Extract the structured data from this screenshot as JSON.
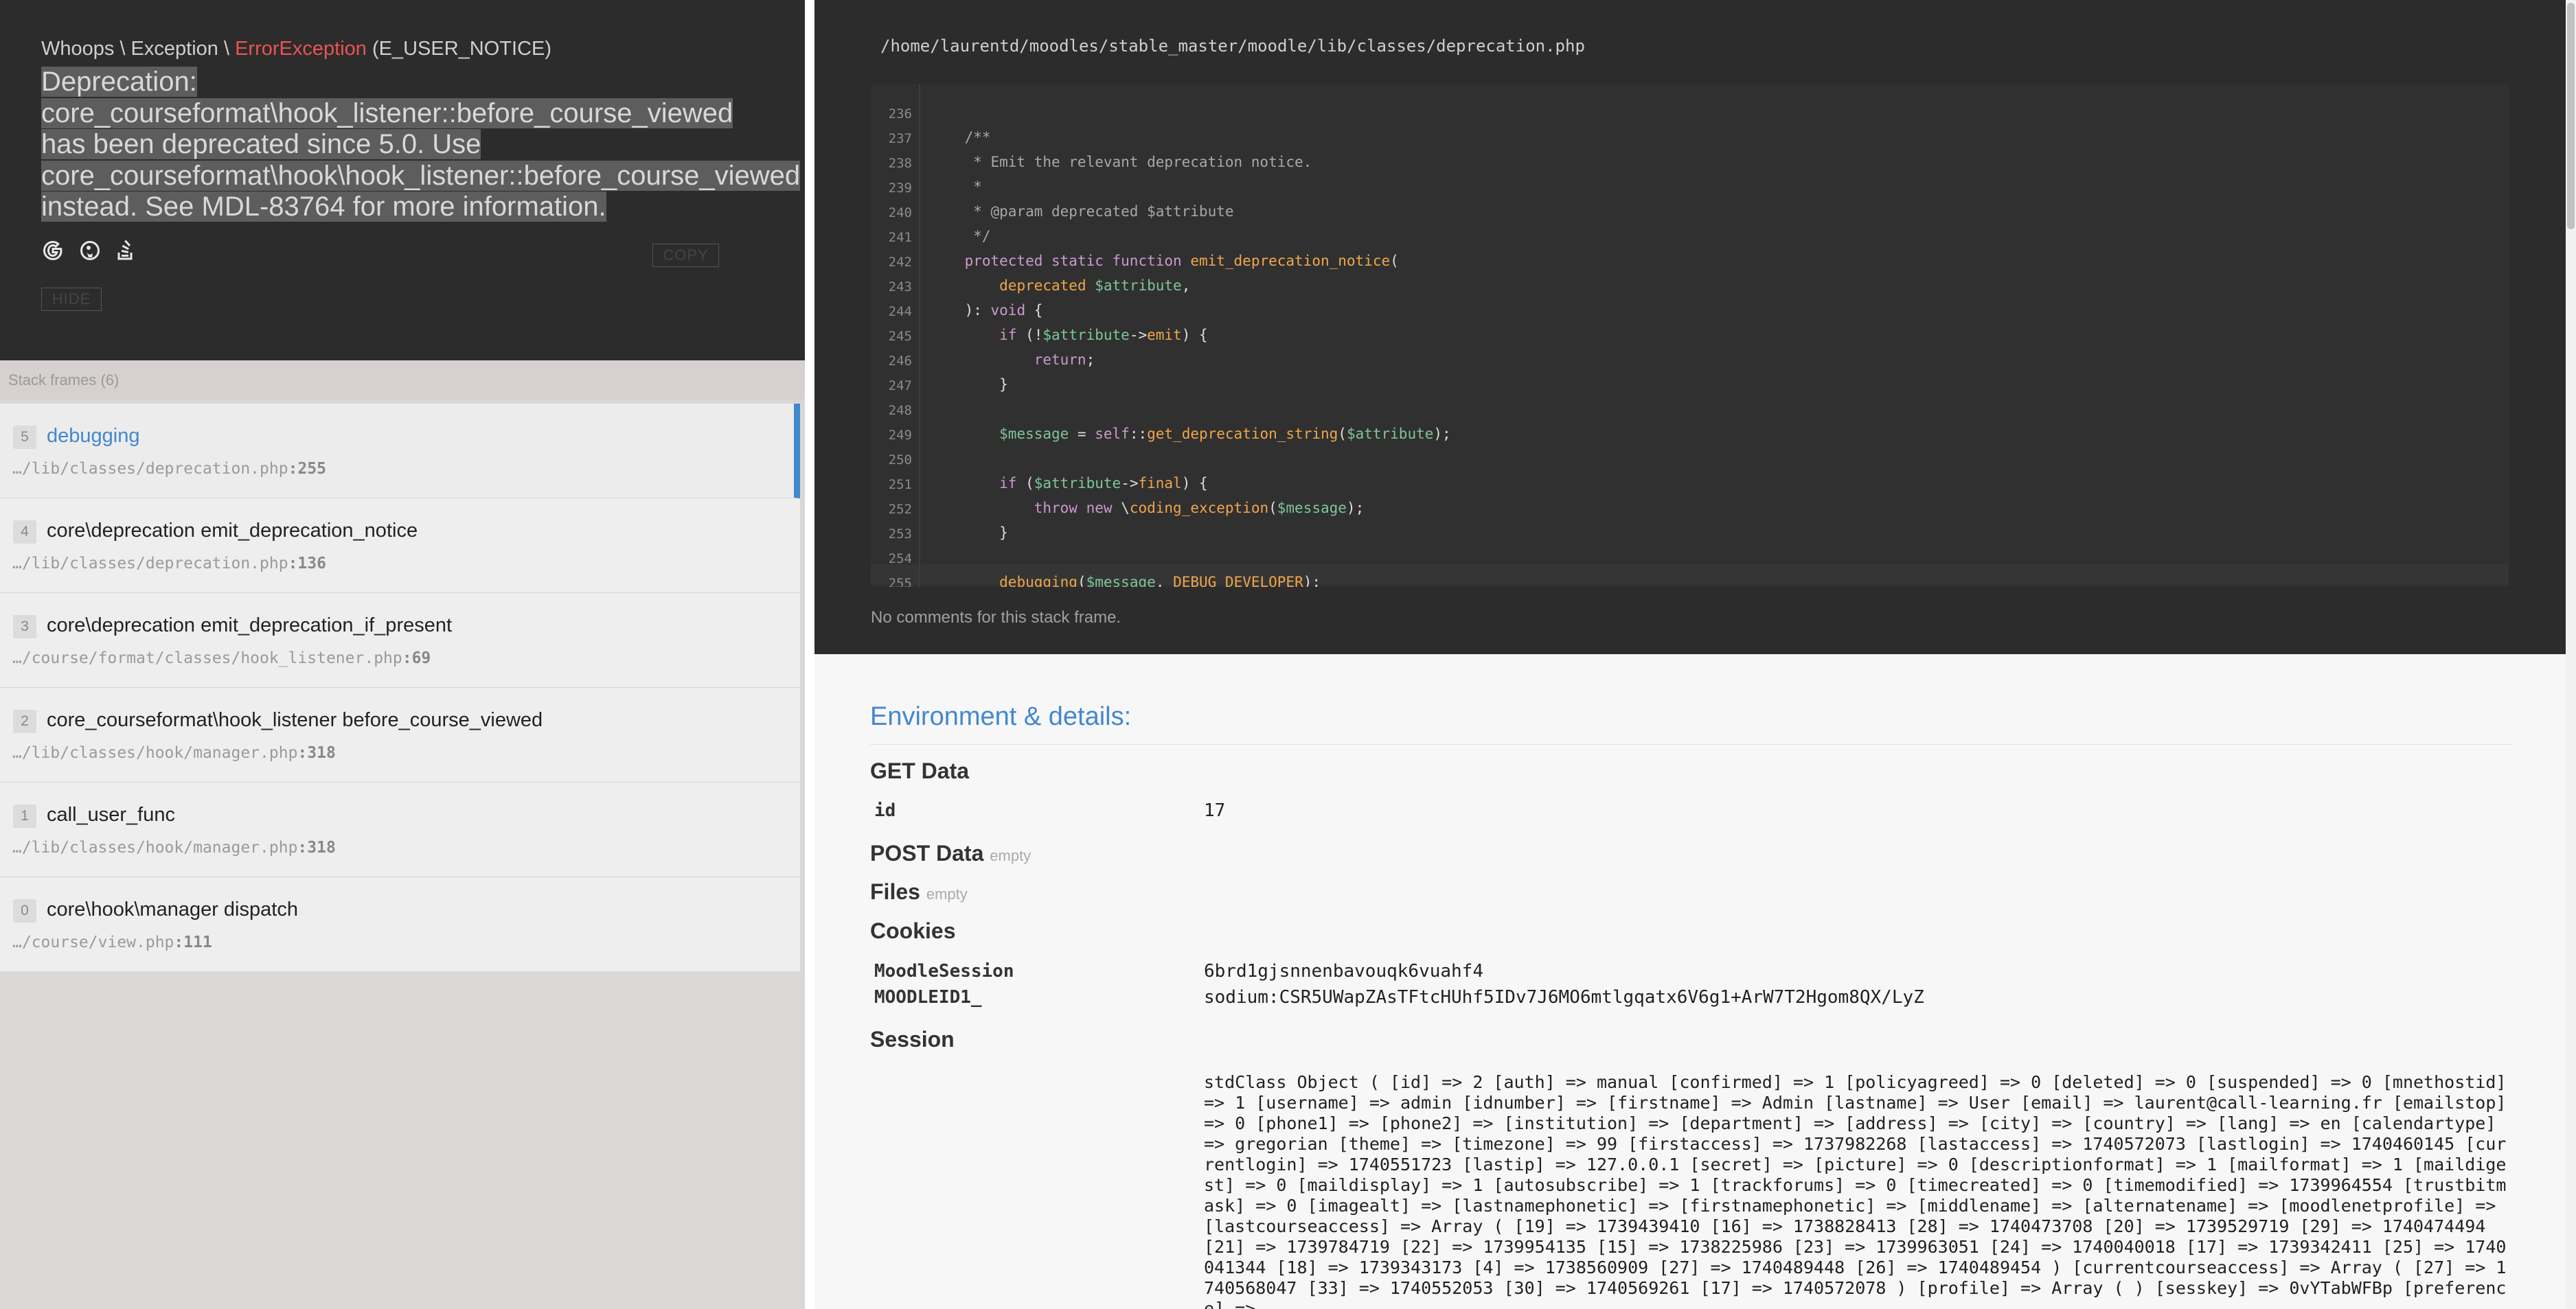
{
  "exception": {
    "namespace": "Whoops \\ Exception \\",
    "class": "ErrorException",
    "type": "(E_USER_NOTICE)",
    "message": "Deprecation: core_courseformat\\hook_listener::before_course_viewed has been deprecated since 5.0. Use core_courseformat\\hook\\hook_listener::before_course_viewed instead. See MDL-83764 for more information.",
    "search_icons": [
      "google-icon",
      "duckduckgo-icon",
      "stackoverflow-icon"
    ],
    "copy_label": "COPY",
    "hide_label": "HIDE"
  },
  "stack": {
    "header": "Stack frames (6)",
    "frames": [
      {
        "index": "5",
        "name": "debugging",
        "file": "…/lib/classes/deprecation.php",
        "line": ":255"
      },
      {
        "index": "4",
        "name": "core\\deprecation emit_deprecation_notice",
        "file": "…/lib/classes/deprecation.php",
        "line": ":136"
      },
      {
        "index": "3",
        "name": "core\\deprecation emit_deprecation_if_present",
        "file": "…/course/format/classes/hook_listener.php",
        "line": ":69"
      },
      {
        "index": "2",
        "name": "core_courseformat\\hook_listener before_course_viewed",
        "file": "…/lib/classes/hook/manager.php",
        "line": ":318"
      },
      {
        "index": "1",
        "name": "call_user_func",
        "file": "…/lib/classes/hook/manager.php",
        "line": ":318"
      },
      {
        "index": "0",
        "name": "core\\hook\\manager dispatch",
        "file": "…/course/view.php",
        "line": ":111"
      }
    ]
  },
  "code": {
    "file_path": "/home/laurentd/moodles/stable_master/moodle/lib/classes/deprecation.php",
    "line_numbers": [
      "236",
      "237",
      "238",
      "239",
      "240",
      "241",
      "242",
      "243",
      "244",
      "245",
      "246",
      "247",
      "248",
      "249",
      "250",
      "251",
      "252",
      "253",
      "254",
      "255"
    ],
    "no_comments": "No comments for this stack frame."
  },
  "details": {
    "title": "Environment & details:",
    "get": {
      "title": "GET Data",
      "key": "id",
      "value": "17"
    },
    "post": {
      "title": "POST Data",
      "empty": "empty"
    },
    "files": {
      "title": "Files",
      "empty": "empty"
    },
    "cookies": {
      "title": "Cookies",
      "rows": [
        {
          "key": "MoodleSession",
          "value": "6brd1gjsnnenbavouqk6vuahf4"
        },
        {
          "key": "MOODLEID1_",
          "value": "sodium:CSR5UWapZAsTFtcHUhf5IDv7J6MO6mtlgqatx6V6g1+ArW7T2Hgom8QX/LyZ"
        }
      ]
    },
    "session": {
      "title": "Session",
      "value": "stdClass Object ( [id] => 2 [auth] => manual [confirmed] => 1 [policyagreed] => 0 [deleted] => 0 [suspended] => 0 [mnethostid] => 1 [username] => admin [idnumber] => [firstname] => Admin [lastname] => User [email] => laurent@call-learning.fr [emailstop] => 0 [phone1] => [phone2] => [institution] => [department] => [address] => [city] => [country] => [lang] => en [calendartype] => gregorian [theme] => [timezone] => 99 [firstaccess] => 1737982268 [lastaccess] => 1740572073 [lastlogin] => 1740460145 [currentlogin] => 1740551723 [lastip] => 127.0.0.1 [secret] => [picture] => 0 [descriptionformat] => 1 [mailformat] => 1 [maildigest] => 0 [maildisplay] => 1 [autosubscribe] => 1 [trackforums] => 0 [timecreated] => 0 [timemodified] => 1739964554 [trustbitmask] => 0 [imagealt] => [lastnamephonetic] => [firstnamephonetic] => [middlename] => [alternatename] => [moodlenetprofile] => [lastcourseaccess] => Array ( [19] => 1739439410 [16] => 1738828413 [28] => 1740473708 [20] => 1739529719 [29] => 1740474494 [21] => 1739784719 [22] => 1739954135 [15] => 1738225986 [23] => 1739963051 [24] => 1740040018 [17] => 1739342411 [25] => 1740041344 [18] => 1739343173 [4] => 1738560909 [27] => 1740489448 [26] => 1740489454 ) [currentcourseaccess] => Array ( [27] => 1740568047 [33] => 1740552053 [30] => 1740569261 [17] => 1740572078 ) [profile] => Array ( ) [sesskey] => 0vYTabWFBp [preference] =>"
    }
  }
}
